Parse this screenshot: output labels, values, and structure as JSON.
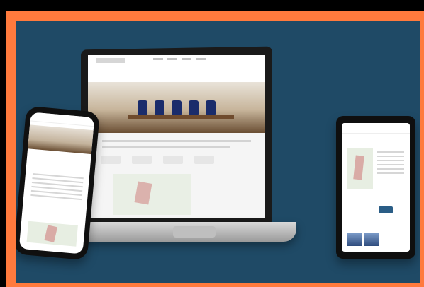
{
  "image": {
    "type": "device-mockup",
    "colors": {
      "outer_background": "#000000",
      "frame": "#ff7a3d",
      "panel": "#1f4a66",
      "device_black": "#101010",
      "laptop_base": "#c8c8c8"
    }
  },
  "devices": {
    "laptop": {
      "screen": {
        "navbar": {
          "logo": "",
          "menu_items": [
            "",
            "",
            "",
            ""
          ]
        },
        "subtitle": "",
        "stats": [
          "",
          "",
          "",
          ""
        ],
        "map": ""
      }
    },
    "phone": {
      "screen": {
        "title": "",
        "map": ""
      }
    },
    "tablet": {
      "screen": {
        "map": ""
      }
    }
  }
}
